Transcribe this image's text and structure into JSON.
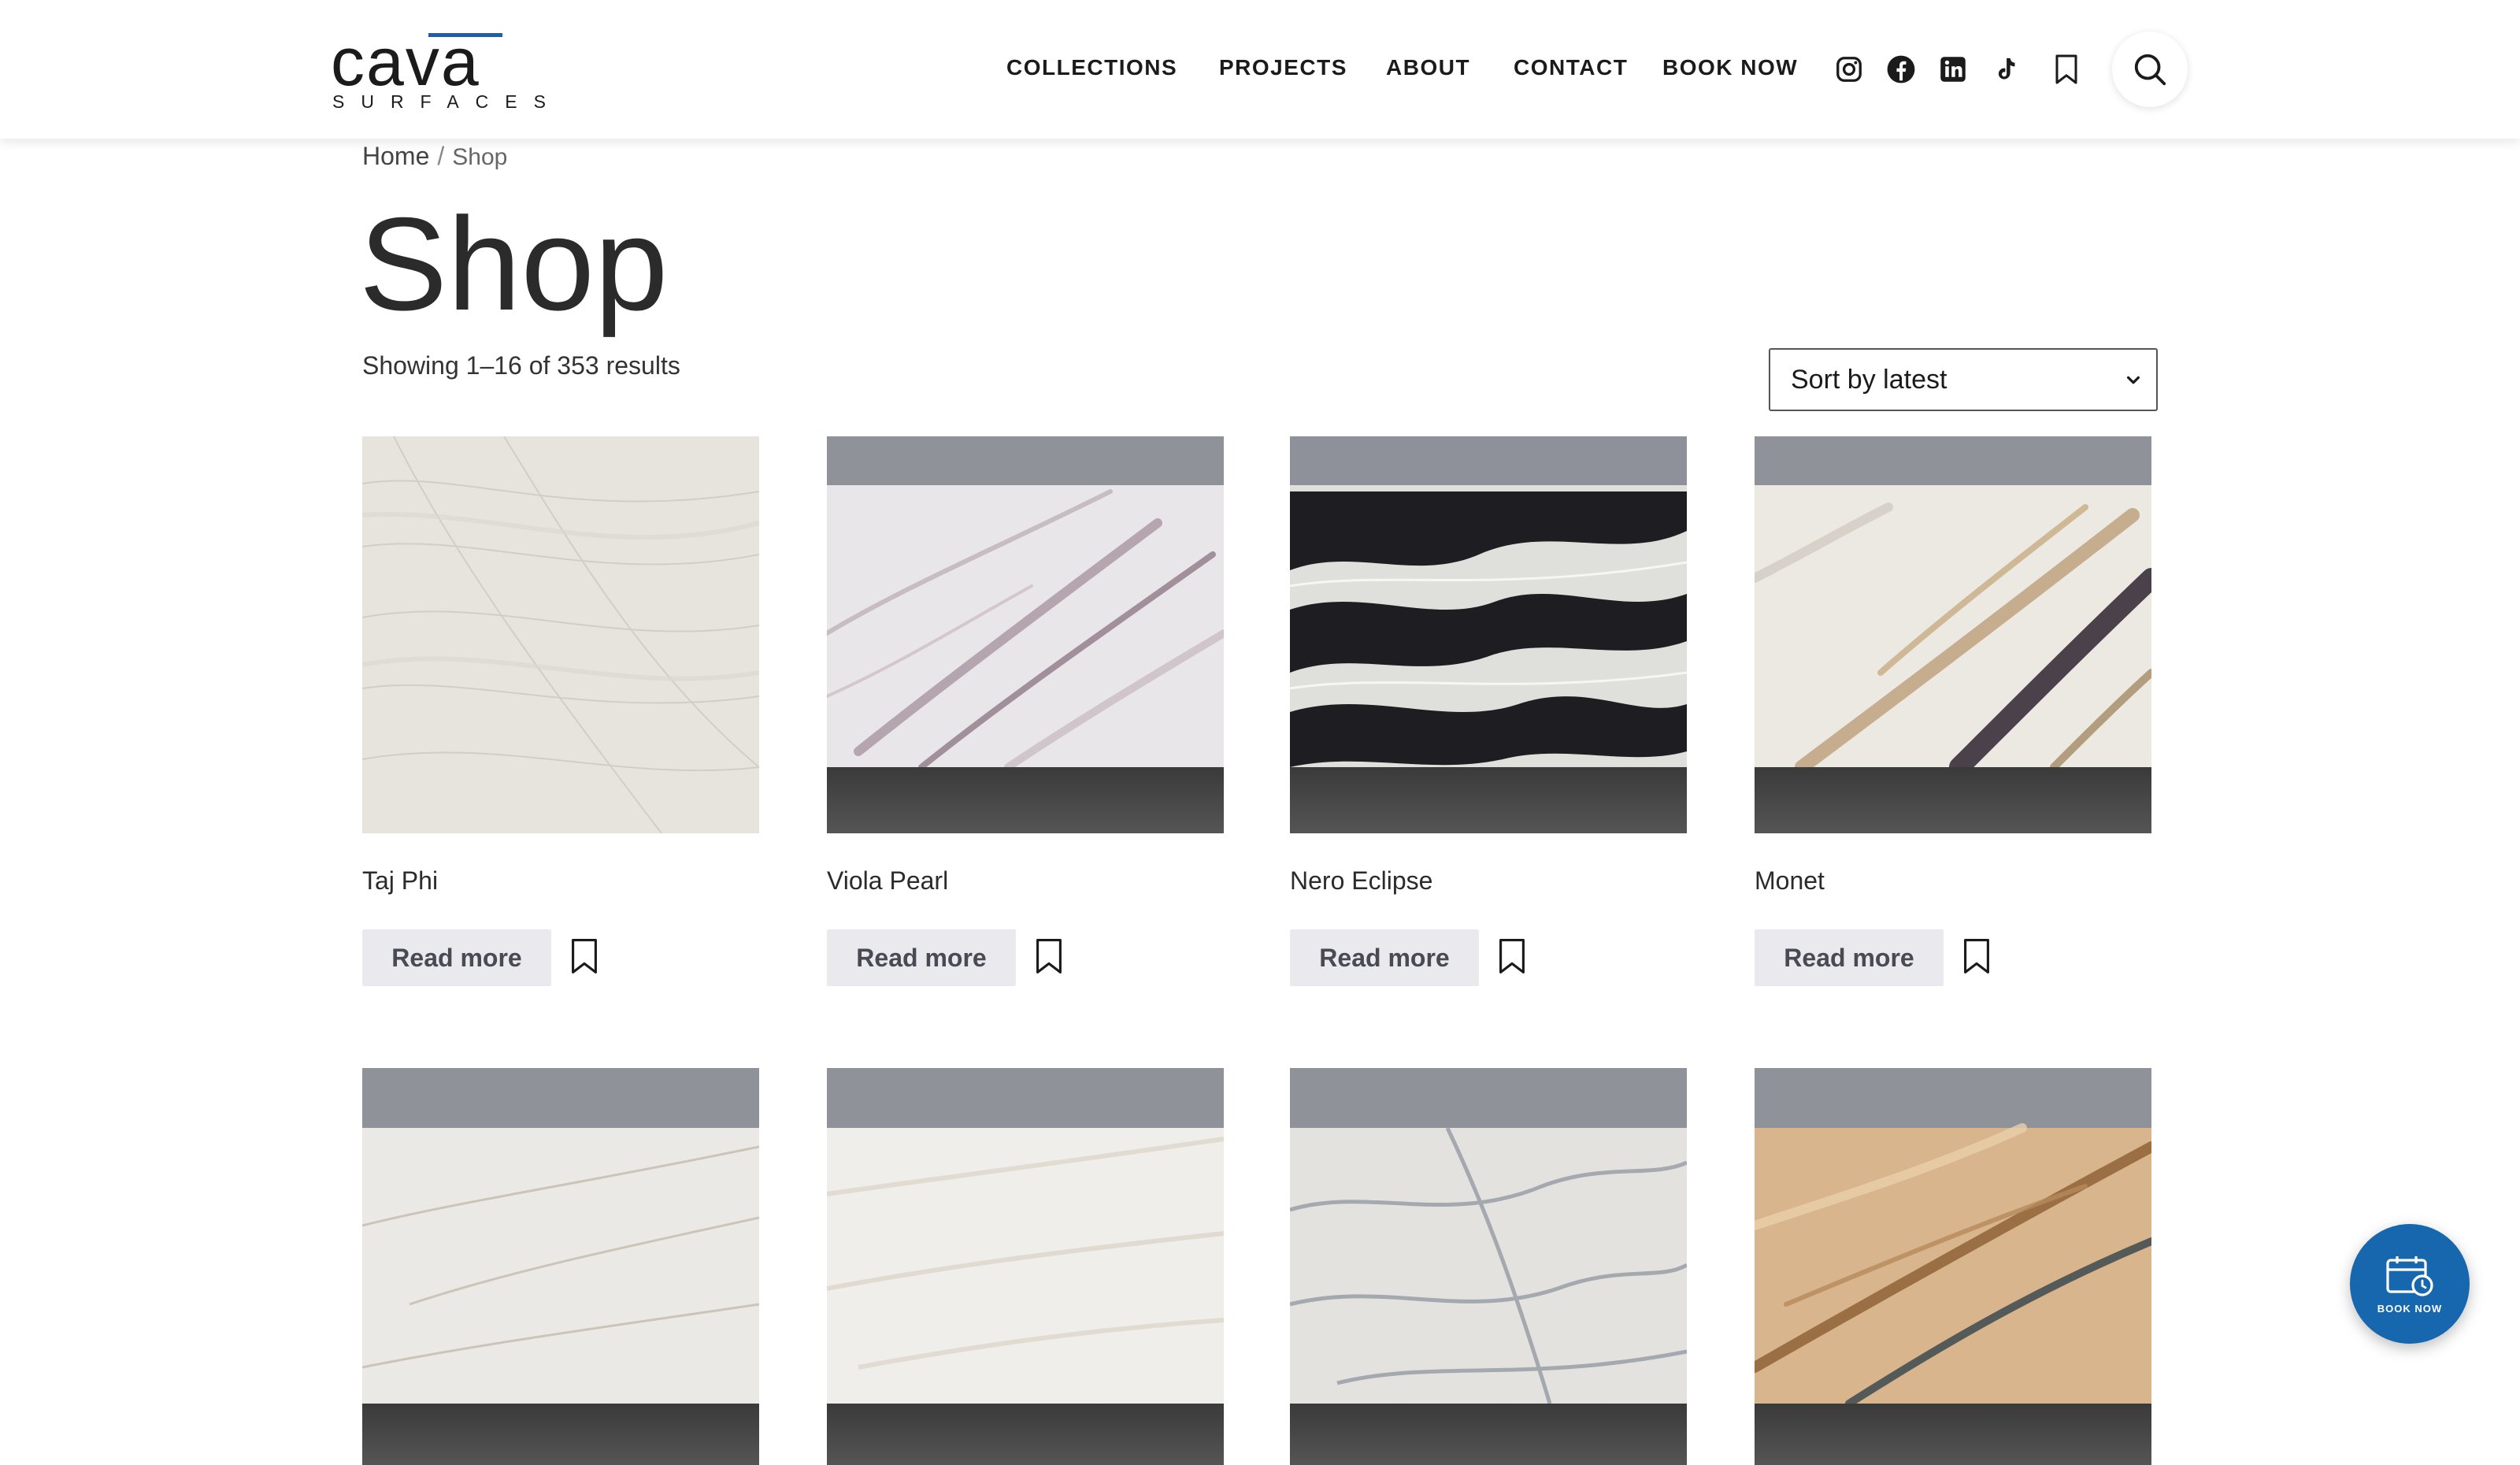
{
  "brand": {
    "logo_word": "cava",
    "logo_sub": "SURFACES",
    "accent": "#1f5fa8"
  },
  "nav": {
    "items": [
      "COLLECTIONS",
      "PROJECTS",
      "ABOUT",
      "CONTACT",
      "BOOK NOW"
    ],
    "social_icons": [
      "instagram-icon",
      "facebook-icon",
      "linkedin-icon",
      "tiktok-icon"
    ],
    "wishlist_icon": "bookmark-icon",
    "search_icon": "search-icon"
  },
  "breadcrumb": {
    "home": "Home",
    "separator": "/",
    "current": "Shop"
  },
  "page": {
    "title": "Shop",
    "result_count": "Showing 1–16 of 353 results"
  },
  "sort": {
    "selected": "Sort by latest"
  },
  "products": [
    {
      "name": "Taj Phi",
      "button": "Read more"
    },
    {
      "name": "Viola Pearl",
      "button": "Read more"
    },
    {
      "name": "Nero Eclipse",
      "button": "Read more"
    },
    {
      "name": "Monet",
      "button": "Read more"
    },
    {
      "name": "",
      "button": ""
    },
    {
      "name": "",
      "button": ""
    },
    {
      "name": "",
      "button": ""
    },
    {
      "name": "",
      "button": ""
    }
  ],
  "fab": {
    "label": "BOOK NOW",
    "color": "#1667ad"
  }
}
